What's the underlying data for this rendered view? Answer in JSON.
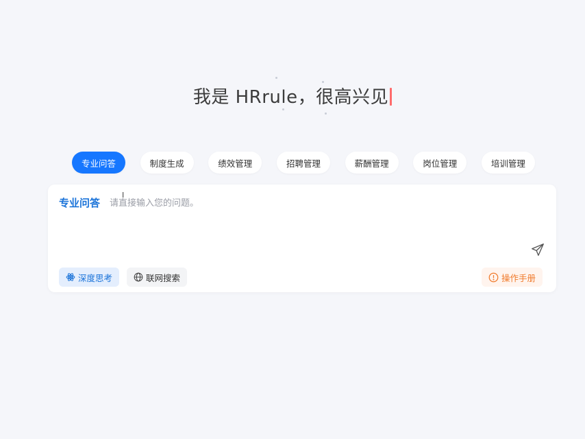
{
  "headline": {
    "text": "我是 HRrule，很高兴见"
  },
  "tabs": [
    {
      "label": "专业问答",
      "active": true
    },
    {
      "label": "制度生成",
      "active": false
    },
    {
      "label": "绩效管理",
      "active": false
    },
    {
      "label": "招聘管理",
      "active": false
    },
    {
      "label": "薪酬管理",
      "active": false
    },
    {
      "label": "岗位管理",
      "active": false
    },
    {
      "label": "培训管理",
      "active": false
    }
  ],
  "composer": {
    "mode_label": "专业问答",
    "placeholder": "请直接输入您的问题。",
    "value": "",
    "send_icon": "paper-plane-icon",
    "deep_think_label": "深度思考",
    "deep_think_icon": "atom-icon",
    "web_search_label": "联网搜索",
    "web_search_icon": "globe-icon",
    "manual_label": "操作手册",
    "manual_icon": "alert-circle-icon"
  },
  "colors": {
    "accent": "#1677ff",
    "mode_label": "#1a73d9",
    "caret": "#ff6b6b",
    "manual": "#f07a2b",
    "background": "#f5f6fa"
  }
}
